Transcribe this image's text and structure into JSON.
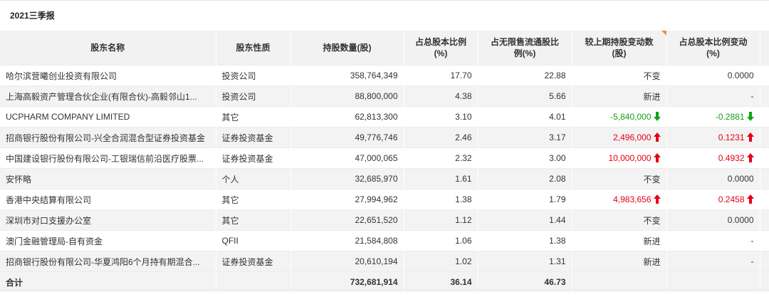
{
  "report": {
    "title": "2021三季报"
  },
  "headers": {
    "name": "股东名称",
    "type": "股东性质",
    "shares": "持股数量(股)",
    "ratio_line1": "占总股本比例",
    "ratio_line2": "(%)",
    "float_line1": "占无限售流通股比",
    "float_line2": "例(%)",
    "change_line1": "较上期持股变动数",
    "change_line2": "(股)",
    "ratio_change_line1": "占总股本比例变动",
    "ratio_change_line2": "(%)"
  },
  "colors": {
    "up": "#e60012",
    "down": "#11a316",
    "header_bg": "#f2f2f2",
    "accent": "#f08a3c"
  },
  "rows": [
    {
      "name": "哈尔滨营曦创业投资有限公司",
      "type": "投资公司",
      "shares": "358,764,349",
      "ratio": "17.70",
      "float": "22.88",
      "change": "不变",
      "ratio_change": "0.0000",
      "trend": "none"
    },
    {
      "name": "上海高毅资产管理合伙企业(有限合伙)-高毅邻山1...",
      "type": "投资公司",
      "shares": "88,800,000",
      "ratio": "4.38",
      "float": "5.66",
      "change": "新进",
      "ratio_change": "-",
      "trend": "none"
    },
    {
      "name": "UCPHARM COMPANY LIMITED",
      "type": "其它",
      "shares": "62,813,300",
      "ratio": "3.10",
      "float": "4.01",
      "change": "-5,840,000",
      "ratio_change": "-0.2881",
      "trend": "down"
    },
    {
      "name": "招商银行股份有限公司-兴全合润混合型证券投资基金",
      "type": "证券投资基金",
      "shares": "49,776,746",
      "ratio": "2.46",
      "float": "3.17",
      "change": "2,496,000",
      "ratio_change": "0.1231",
      "trend": "up"
    },
    {
      "name": "中国建设银行股份有限公司-工银瑞信前沿医疗股票...",
      "type": "证券投资基金",
      "shares": "47,000,065",
      "ratio": "2.32",
      "float": "3.00",
      "change": "10,000,000",
      "ratio_change": "0.4932",
      "trend": "up"
    },
    {
      "name": "安怀略",
      "type": "个人",
      "shares": "32,685,970",
      "ratio": "1.61",
      "float": "2.08",
      "change": "不变",
      "ratio_change": "0.0000",
      "trend": "none"
    },
    {
      "name": "香港中央结算有限公司",
      "type": "其它",
      "shares": "27,994,962",
      "ratio": "1.38",
      "float": "1.79",
      "change": "4,983,656",
      "ratio_change": "0.2458",
      "trend": "up"
    },
    {
      "name": "深圳市对口支援办公室",
      "type": "其它",
      "shares": "22,651,520",
      "ratio": "1.12",
      "float": "1.44",
      "change": "不变",
      "ratio_change": "0.0000",
      "trend": "none"
    },
    {
      "name": "澳门金融管理局-自有资金",
      "type": "QFII",
      "shares": "21,584,808",
      "ratio": "1.06",
      "float": "1.38",
      "change": "新进",
      "ratio_change": "-",
      "trend": "none"
    },
    {
      "name": "招商银行股份有限公司-华夏鸿阳6个月持有期混合...",
      "type": "证券投资基金",
      "shares": "20,610,194",
      "ratio": "1.02",
      "float": "1.31",
      "change": "新进",
      "ratio_change": "-",
      "trend": "none"
    }
  ],
  "total": {
    "label": "合计",
    "shares": "732,681,914",
    "ratio": "36.14",
    "float": "46.73"
  }
}
